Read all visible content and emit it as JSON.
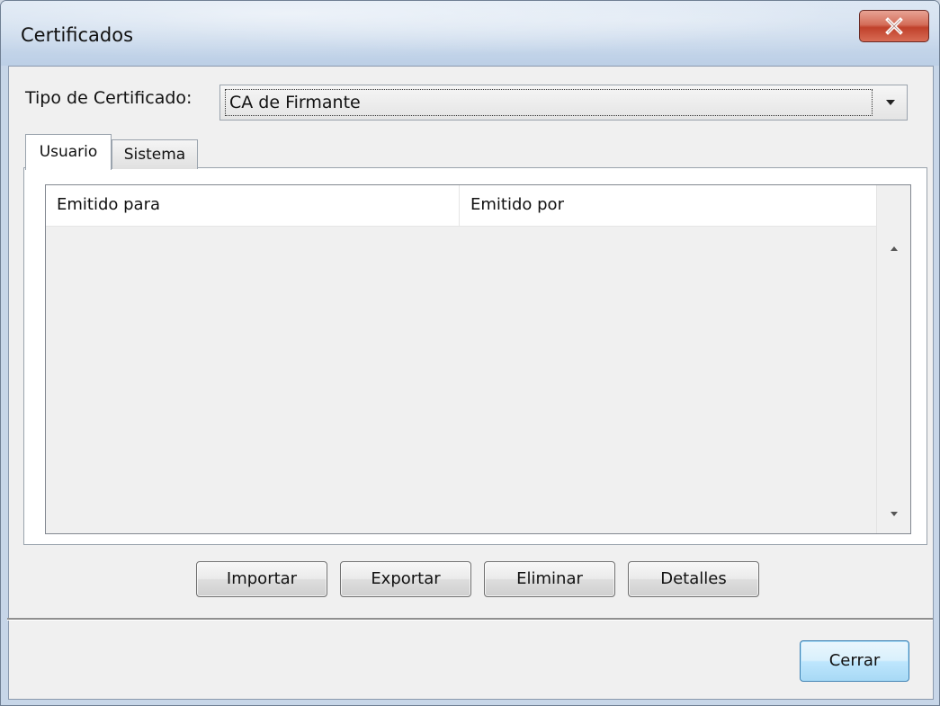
{
  "window": {
    "title": "Certificados",
    "close_icon": "close-x-icon"
  },
  "certificate_type": {
    "label": "Tipo de Certificado:",
    "selected": "CA de Firmante",
    "dropdown_icon": "chevron-down-icon"
  },
  "tabs": [
    {
      "label": "Usuario",
      "active": true
    },
    {
      "label": "Sistema",
      "active": false
    }
  ],
  "list": {
    "columns": [
      "Emitido para",
      "Emitido por"
    ],
    "rows": []
  },
  "actions": {
    "import_label": "Importar",
    "export_label": "Exportar",
    "delete_label": "Eliminar",
    "details_label": "Detalles"
  },
  "footer": {
    "close_label": "Cerrar"
  },
  "colors": {
    "close_button": "#c9452e",
    "default_button_border": "#3c7fb1"
  }
}
